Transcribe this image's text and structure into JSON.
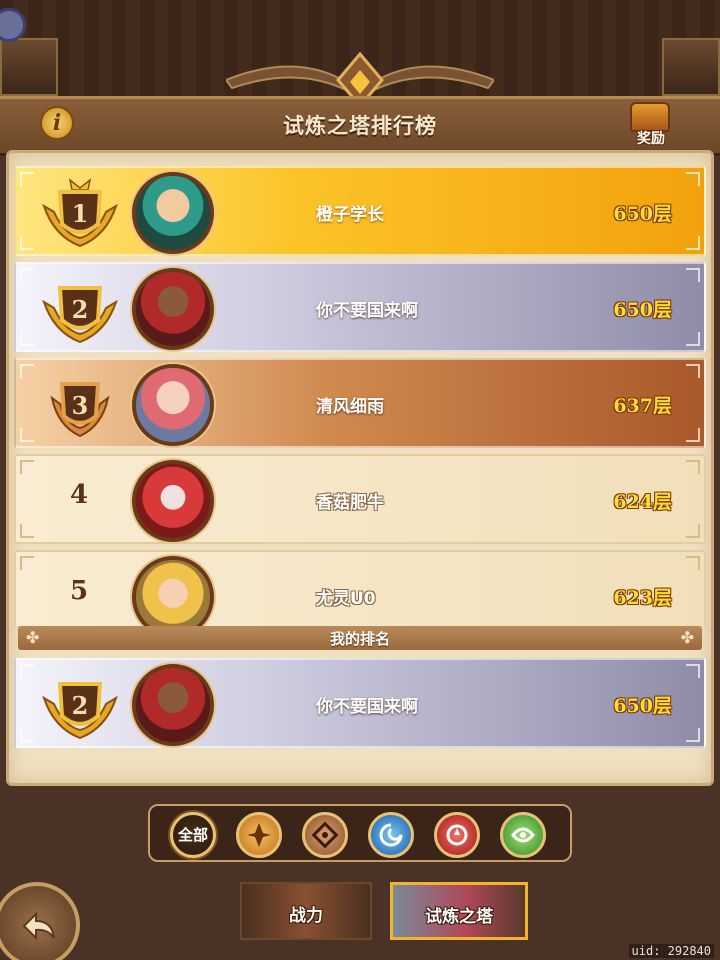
{
  "header": {
    "title": "试炼之塔排行榜",
    "info_icon": "info-icon",
    "reward_label": "奖励"
  },
  "leaderboard": [
    {
      "rank": "1",
      "name": "橙子学长",
      "floor": "650层",
      "tier": "gold"
    },
    {
      "rank": "2",
      "name": "你不要国来啊",
      "floor": "650层",
      "tier": "silver"
    },
    {
      "rank": "3",
      "name": "清风细雨",
      "floor": "637层",
      "tier": "bronze"
    },
    {
      "rank": "4",
      "name": "香菇肥牛",
      "floor": "624层",
      "tier": "plain"
    },
    {
      "rank": "5",
      "name": "尤灵U0",
      "floor": "623层",
      "tier": "plain"
    }
  ],
  "my_rank": {
    "label": "我的排名",
    "rank": "2",
    "name": "你不要国来啊",
    "floor": "650层"
  },
  "filters": {
    "all_label": "全部",
    "icons": [
      "faction-light-icon",
      "faction-earth-icon",
      "faction-water-icon",
      "faction-fire-icon",
      "faction-wind-icon"
    ]
  },
  "tabs": {
    "power": "战力",
    "tower": "试炼之塔"
  },
  "footer": {
    "uid": "uid: 292840"
  },
  "colors": {
    "gold_row": "#fcc42a",
    "silver_row": "#c6c4d8",
    "bronze_row": "#d08a4f",
    "floor_text": "#ffdc3a",
    "panel_bg": "#efe0bf"
  }
}
